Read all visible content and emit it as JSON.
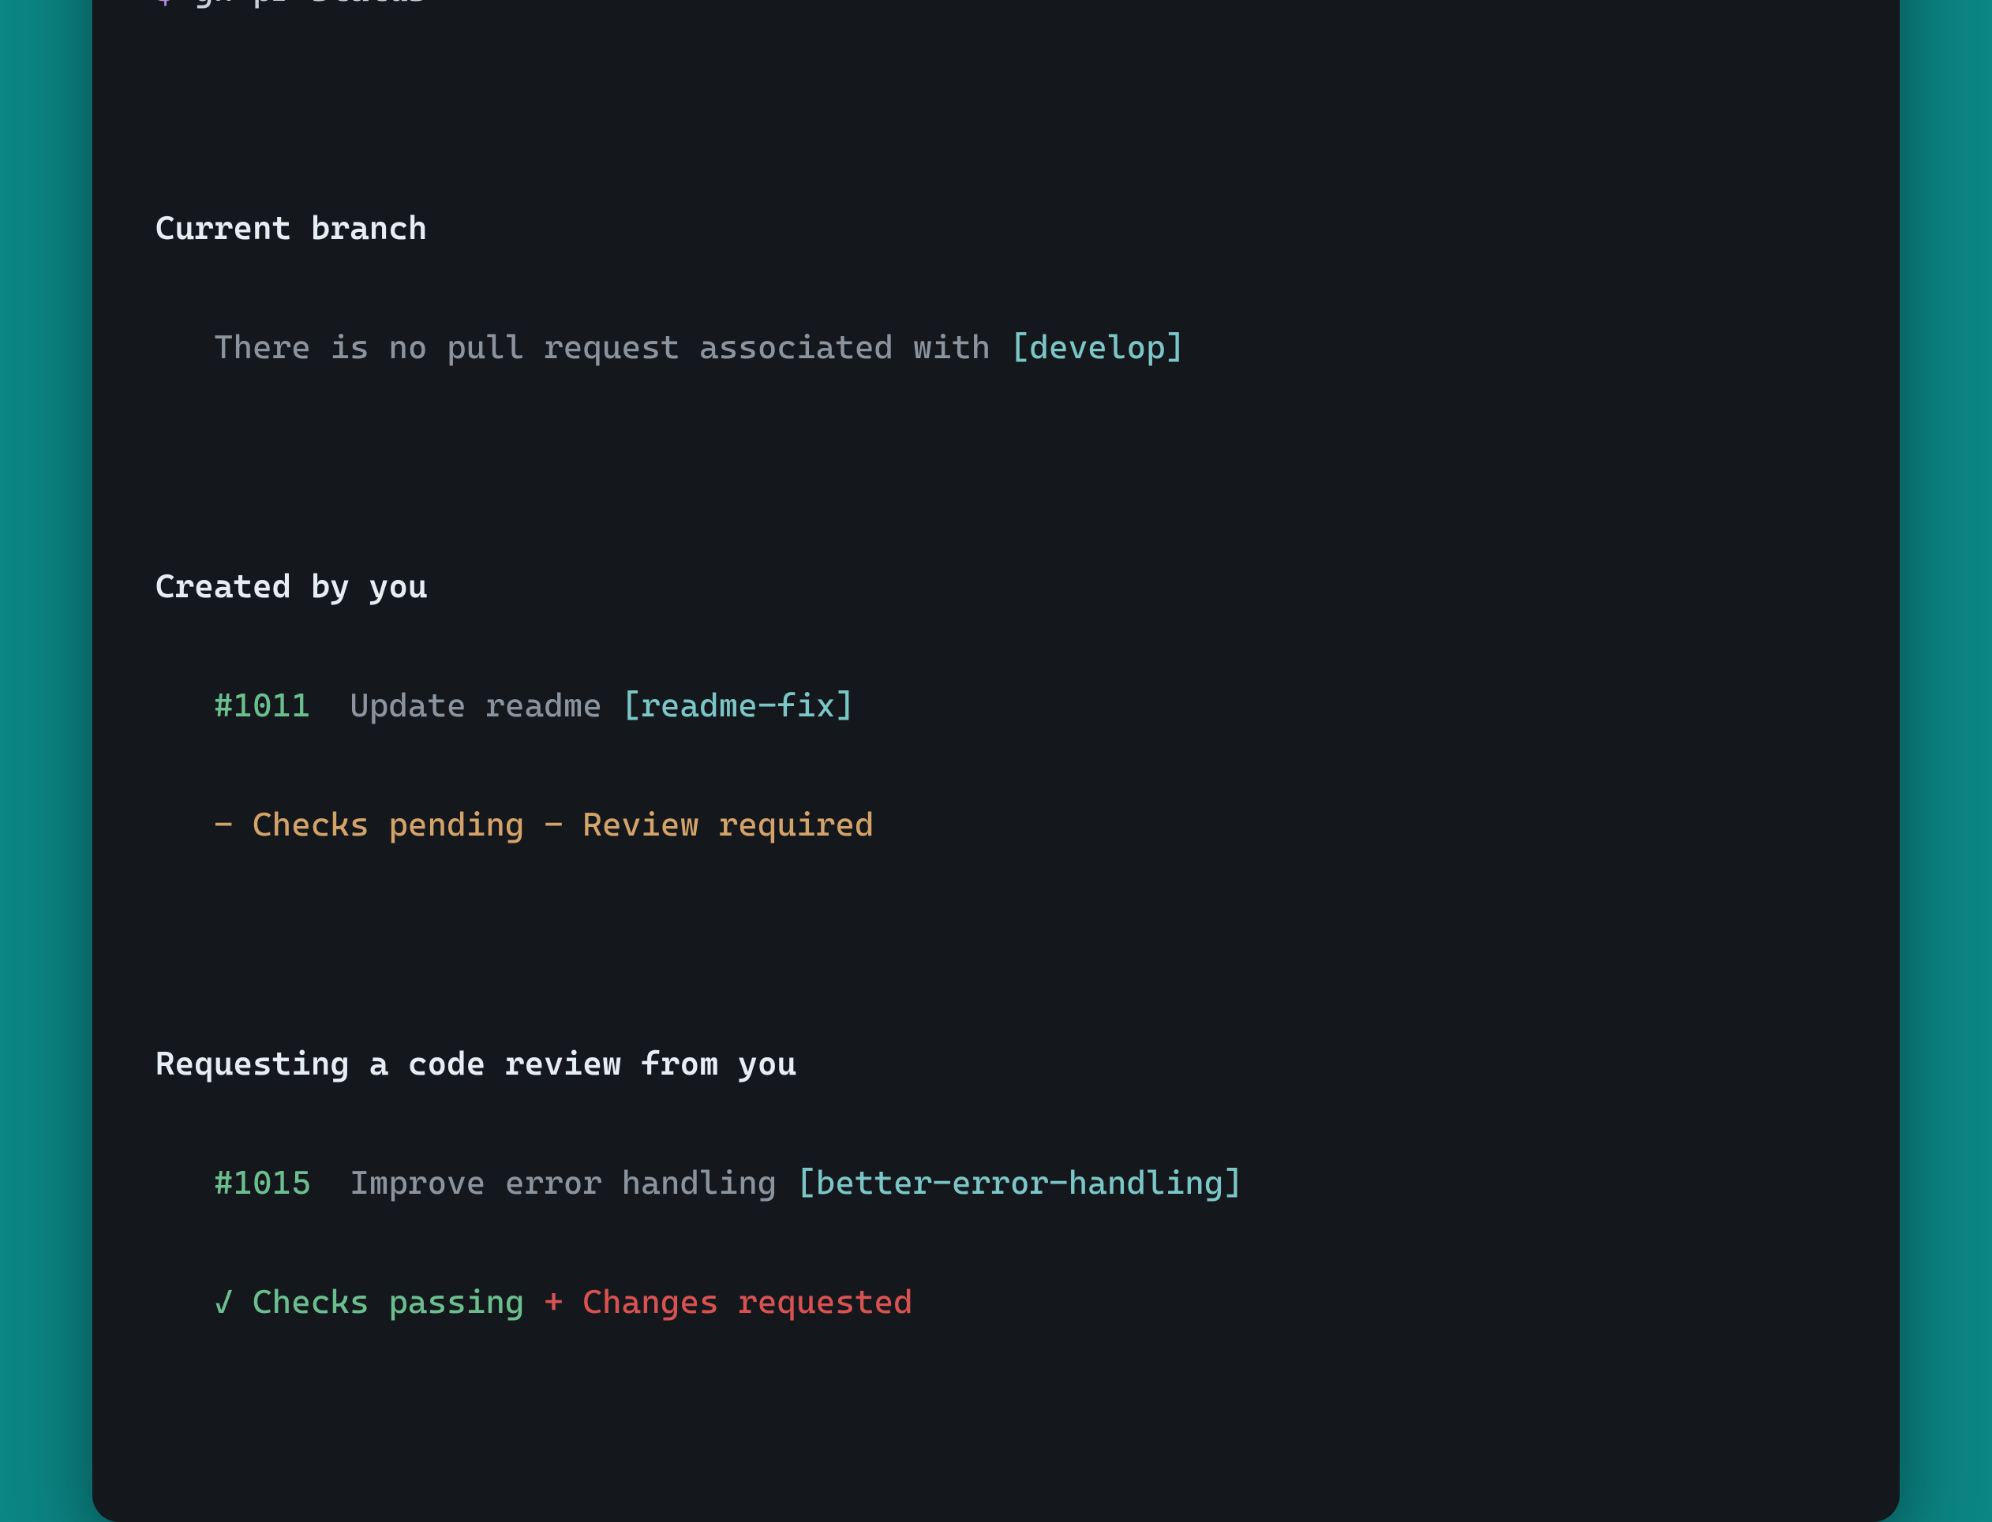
{
  "prompt": {
    "symbol": "$",
    "command": "gh pr status"
  },
  "sections": {
    "current_branch": {
      "heading": "Current branch",
      "message_prefix": "There is no pull request associated with ",
      "branch": "[develop]"
    },
    "created_by_you": {
      "heading": "Created by you",
      "pr_number": "#1011",
      "pr_title": "Update readme",
      "pr_branch": "[readme-fix]",
      "status_line": "- Checks pending - Review required"
    },
    "review_requested": {
      "heading": "Requesting a code review from you",
      "pr_number": "#1015",
      "pr_title": "Improve error handling",
      "pr_branch": "[better-error-handling]",
      "checks_pass": "✓ Checks passing",
      "changes_req": "+ Changes requested"
    }
  }
}
